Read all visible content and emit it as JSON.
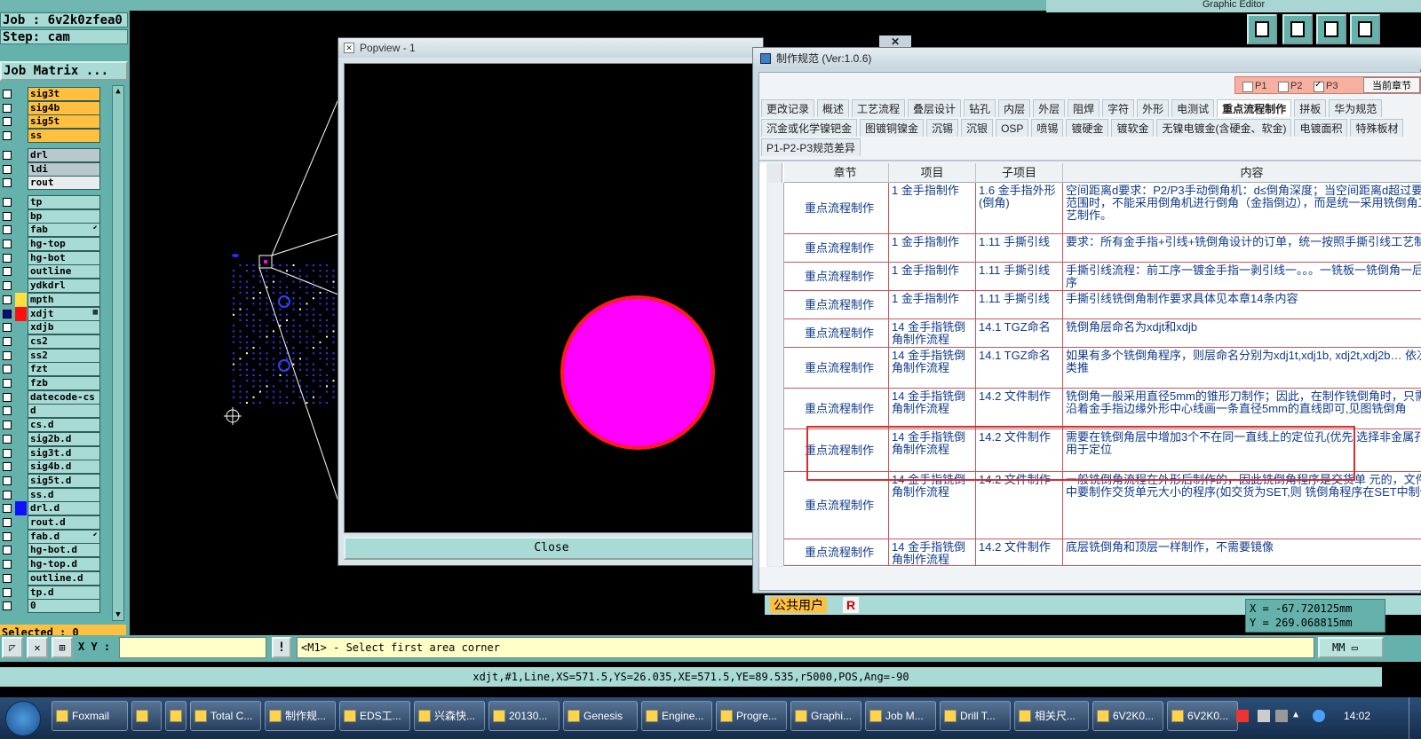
{
  "top_bar": {
    "right_title": "Graphic Editor"
  },
  "job_panel": {
    "job_line": "Job : 6v2k0zfea0",
    "step_line": "Step: cam",
    "job_matrix_label": "Job Matrix ...",
    "layers": [
      {
        "name": "sig3t",
        "kind": "signal",
        "checked": false
      },
      {
        "name": "sig4b",
        "kind": "signal",
        "checked": false
      },
      {
        "name": "sig5t",
        "kind": "signal",
        "checked": false
      },
      {
        "name": "ss",
        "kind": "signal",
        "checked": false
      },
      {
        "name": "drl",
        "kind": "drill",
        "checked": false
      },
      {
        "name": "ldi",
        "kind": "drill",
        "checked": false
      },
      {
        "name": "rout",
        "kind": "white",
        "checked": false
      },
      {
        "name": "tp",
        "kind": "doc",
        "checked": false
      },
      {
        "name": "bp",
        "kind": "doc",
        "checked": false
      },
      {
        "name": "fab",
        "kind": "doc",
        "checked": false,
        "mark": "⬋"
      },
      {
        "name": "hg-top",
        "kind": "doc",
        "checked": false
      },
      {
        "name": "hg-bot",
        "kind": "doc",
        "checked": false
      },
      {
        "name": "outline",
        "kind": "doc",
        "checked": false
      },
      {
        "name": "ydkdrl",
        "kind": "doc",
        "checked": false
      },
      {
        "name": "mpth",
        "kind": "doc",
        "checked": false,
        "color": "#ffe040"
      },
      {
        "name": "xdjt",
        "kind": "doc",
        "checked": true,
        "color": "#ff1010",
        "mark": "▦"
      },
      {
        "name": "xdjb",
        "kind": "doc",
        "checked": false
      },
      {
        "name": "cs2",
        "kind": "doc",
        "checked": false
      },
      {
        "name": "ss2",
        "kind": "doc",
        "checked": false
      },
      {
        "name": "fzt",
        "kind": "doc",
        "checked": false
      },
      {
        "name": "fzb",
        "kind": "doc",
        "checked": false
      },
      {
        "name": "datecode-cs",
        "kind": "doc",
        "checked": false
      },
      {
        "name": "d",
        "kind": "doc",
        "checked": false
      },
      {
        "name": "cs.d",
        "kind": "doc",
        "checked": false
      },
      {
        "name": "sig2b.d",
        "kind": "doc",
        "checked": false
      },
      {
        "name": "sig3t.d",
        "kind": "doc",
        "checked": false
      },
      {
        "name": "sig4b.d",
        "kind": "doc",
        "checked": false
      },
      {
        "name": "sig5t.d",
        "kind": "doc",
        "checked": false
      },
      {
        "name": "ss.d",
        "kind": "doc",
        "checked": false
      },
      {
        "name": "drl.d",
        "kind": "doc",
        "checked": false,
        "color": "#1010ff"
      },
      {
        "name": "rout.d",
        "kind": "doc",
        "checked": false
      },
      {
        "name": "fab.d",
        "kind": "doc",
        "checked": false,
        "mark": "⬋"
      },
      {
        "name": "hg-bot.d",
        "kind": "doc",
        "checked": false
      },
      {
        "name": "hg-top.d",
        "kind": "doc",
        "checked": false
      },
      {
        "name": "outline.d",
        "kind": "doc",
        "checked": false
      },
      {
        "name": "tp.d",
        "kind": "doc",
        "checked": false
      },
      {
        "name": "0",
        "kind": "doc",
        "checked": false
      }
    ],
    "selected_label": "Selected : 0"
  },
  "popview": {
    "title": "Popview - 1",
    "close_label": "Close",
    "circle_color": "#ff00ff",
    "circle_border": "#ff1a1a"
  },
  "spec_window": {
    "title": "制作规范 (Ver:1.0.6)",
    "p_toggles": [
      {
        "label": "P1",
        "on": false
      },
      {
        "label": "P2",
        "on": false
      },
      {
        "label": "P3",
        "on": true
      }
    ],
    "current_section_label": "当前章节",
    "tabs_row1": [
      "更改记录",
      "概述",
      "工艺流程",
      "叠层设计",
      "钻孔",
      "内层",
      "外层",
      "阻焊",
      "字符",
      "外形",
      "电测试",
      "重点流程制作",
      "拼板",
      "华为规范"
    ],
    "active_tab": "重点流程制作",
    "tabs_row2": [
      "沉金或化学镍钯金",
      "图镀铜镍金",
      "沉锡",
      "沉银",
      "OSP",
      "喷锡",
      "镀硬金",
      "镀软金",
      "无镍电镀金(含硬金、软金)",
      "电镀面积",
      "特殊板材"
    ],
    "tabs_row3": [
      "P1-P2-P3规范差异"
    ],
    "columns": [
      "章节",
      "项目",
      "子项目",
      "内容"
    ],
    "rows": [
      {
        "chapter": "重点流程制作",
        "item": "1 金手指制作",
        "sub": "1.6 金手指外形(倒角)",
        "content": "空间距离d要求：P2/P3手动倒角机：d≤倒角深度；当空间距离d超过要求范围时，不能采用倒角机进行倒角（金指倒边），而是统一采用铣倒角工艺制作。"
      },
      {
        "chapter": "重点流程制作",
        "item": "1 金手指制作",
        "sub": "1.11 手撕引线",
        "content": "要求：所有金手指+引线+铣倒角设计的订单，统一按照手撕引线工艺制作"
      },
      {
        "chapter": "重点流程制作",
        "item": "1 金手指制作",
        "sub": "1.11 手撕引线",
        "content": "手撕引线流程：前工序一镀金手指一剥引线一。。。一铣板一铣倒角一后工序"
      },
      {
        "chapter": "重点流程制作",
        "item": "1 金手指制作",
        "sub": "1.11 手撕引线",
        "content": "手撕引线铣倒角制作要求具体见本章14条内容"
      },
      {
        "chapter": "重点流程制作",
        "item": "14 金手指铣倒角制作流程",
        "sub": "14.1 TGZ命名",
        "content": "铣倒角层命名为xdjt和xdjb"
      },
      {
        "chapter": "重点流程制作",
        "item": "14 金手指铣倒角制作流程",
        "sub": "14.1 TGZ命名",
        "content": "如果有多个铣倒角程序，则层命名分别为xdj1t,xdj1b,     xdj2t,xdj2b… 依次类推"
      },
      {
        "chapter": "重点流程制作",
        "item": "14 金手指铣倒角制作流程",
        "sub": "14.2 文件制作",
        "content": "铣倒角一般采用直径5mm的锥形刀制作；因此，在制作铣倒角时，只需要沿着金手指边缘外形中心线画一条直径5mm的直线即可,见图铣倒角"
      },
      {
        "chapter": "重点流程制作",
        "item": "14 金手指铣倒角制作流程",
        "sub": "14.2 文件制作",
        "content": "需要在铣倒角层中增加3个不在同一直线上的定位孔(优先     选择非金属孔),用于定位"
      },
      {
        "chapter": "重点流程制作",
        "item": "14 金手指铣倒角制作流程",
        "sub": "14.2 文件制作",
        "content": "一般铣倒角流程在外形后制作的，因此铣倒角程序是交货单     元的，文件中要制作交货单元大小的程序(如交货为SET,则     铣倒角程序在SET中制作)"
      },
      {
        "chapter": "重点流程制作",
        "item": "14 金手指铣倒角制作流程",
        "sub": "14.2 文件制作",
        "content": "底层铣倒角和顶层一样制作，不需要镜像"
      }
    ],
    "status_user": "公共用户",
    "status_r": "R"
  },
  "coords": {
    "x_line": "X = -67.720125mm",
    "y_line": "Y = 269.068815mm"
  },
  "command_bar": {
    "xy_label": "X Y :",
    "xy_value": "",
    "bang_label": "!",
    "prompt": "<M1> - Select first area corner",
    "unit": "MM"
  },
  "info_line": "xdjt,#1,Line,XS=571.5,YS=26.035,XE=571.5,YE=89.535,r5000,POS,Ang=-90",
  "taskbar": {
    "tasks": [
      "Foxmail",
      "",
      "",
      "Total C...",
      "制作规...",
      "EDS工...",
      "兴森快...",
      "20130...",
      "Genesis",
      "Engine...",
      "Progre...",
      "Graphi...",
      "Job M...",
      "Drill T...",
      "相关尺...",
      "6V2K0...",
      "6V2K0..."
    ],
    "clock": "14:02"
  }
}
